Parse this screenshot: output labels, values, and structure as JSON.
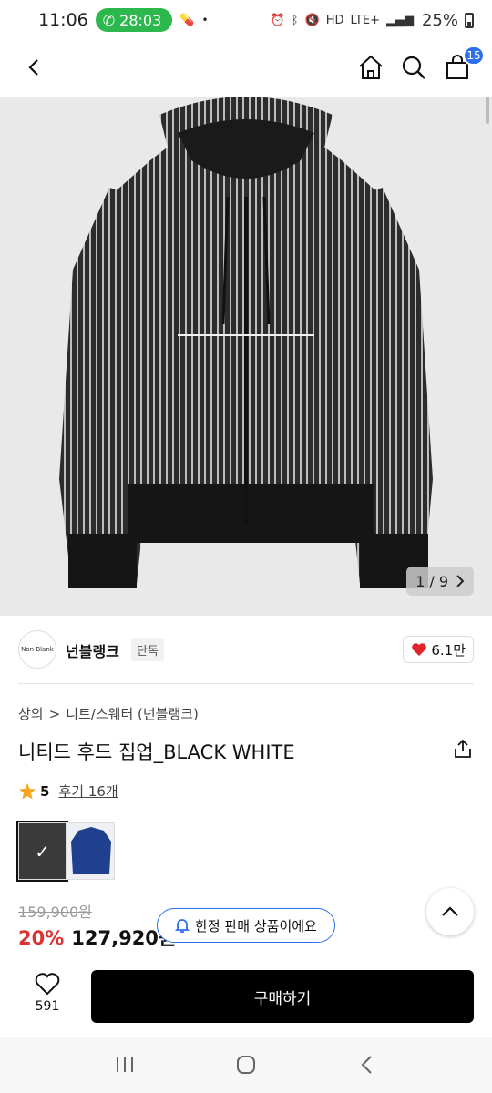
{
  "status_bar": {
    "time": "11:06",
    "call_timer": "28:03",
    "battery": "25%",
    "network": "LTE+"
  },
  "header": {
    "cart_count": "15"
  },
  "image": {
    "counter": "1 / 9",
    "label_text": "Non Blank"
  },
  "brand": {
    "logo_text": "Non Blank",
    "name": "넌블랭크",
    "tag": "단독",
    "likes": "6.1만"
  },
  "breadcrumb": {
    "cat1": "상의",
    "sep": ">",
    "cat2": "니트/스웨터 (넌블랭크)"
  },
  "product": {
    "title": "니티드 후드 집업_BLACK WHITE",
    "rating": "5",
    "reviews": "후기 16개",
    "colors": [
      {
        "name": "black-white",
        "selected": true,
        "swatch": "#3a3a3a"
      },
      {
        "name": "navy",
        "selected": false,
        "swatch": "#1f3f8f"
      }
    ],
    "original_price": "159,900원",
    "discount": "20%",
    "sale_price": "127,920원"
  },
  "toast": {
    "text": "한정 판매 상품이에요"
  },
  "buy_bar": {
    "wish_count": "591",
    "buy_label": "구매하기"
  },
  "colors": {
    "accent_blue": "#2f6fed",
    "discount_red": "#e03131",
    "call_green": "#2db84d",
    "heart_red": "#e0242c"
  }
}
